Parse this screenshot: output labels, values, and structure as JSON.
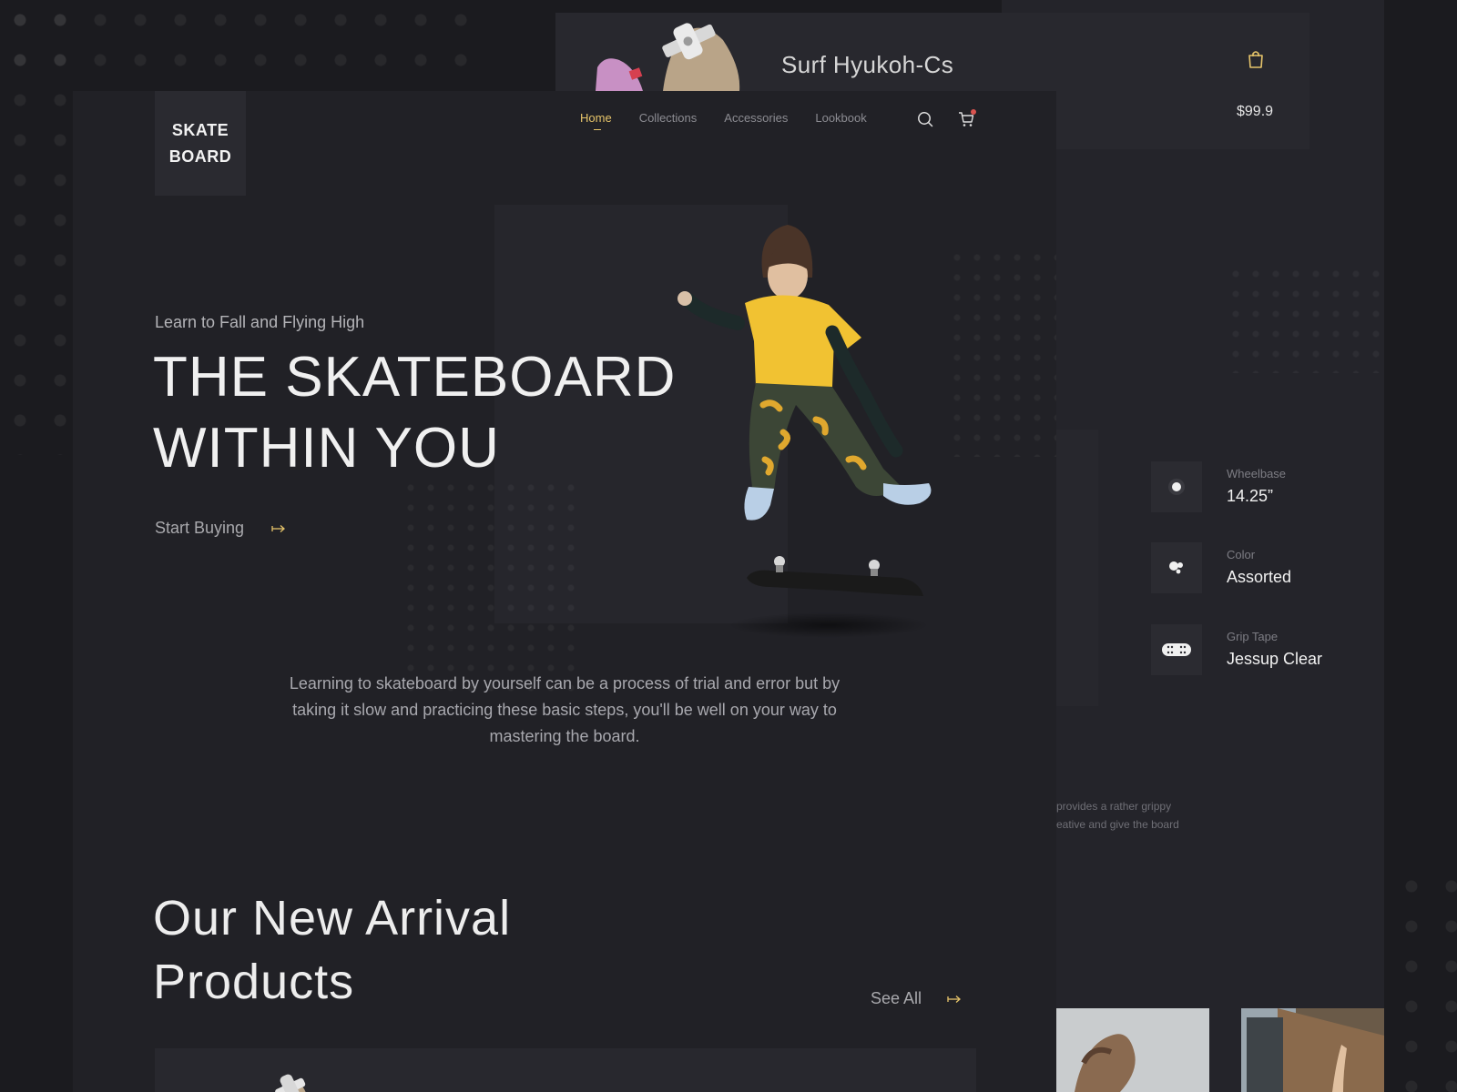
{
  "logo": {
    "line1": "SKATE",
    "line2": "BOARD"
  },
  "nav": {
    "items": [
      {
        "label": "Home",
        "active": true
      },
      {
        "label": "Collections",
        "active": false
      },
      {
        "label": "Accessories",
        "active": false
      },
      {
        "label": "Lookbook",
        "active": false
      }
    ],
    "search_icon": "search-icon",
    "cart_icon": "cart-icon"
  },
  "top_product": {
    "name": "Surf Hyukoh-Cs",
    "price": "$99.9",
    "bag_icon": "shopping-bag-icon"
  },
  "hero": {
    "tagline": "Learn to Fall and Flying High",
    "headline_line1": "THE SKATEBOARD",
    "headline_line2": "WITHIN YOU",
    "cta_label": "Start Buying",
    "description": "Learning to skateboard by yourself can be a process of trial and error but by taking it slow and practicing these basic steps, you'll be well on your way to mastering the board."
  },
  "arrivals": {
    "title_line1": "Our New Arrival",
    "title_line2": "Products",
    "see_all_label": "See All"
  },
  "specs": [
    {
      "label": "Wheelbase",
      "value": "14.25”",
      "icon": "wheel-icon"
    },
    {
      "label": "Color",
      "value": "Assorted",
      "icon": "color-dots-icon"
    },
    {
      "label": "Grip Tape",
      "value": "Jessup Clear",
      "icon": "grip-tape-icon"
    }
  ],
  "side_snippet": {
    "line1": "provides a rather grippy",
    "line2": "eative and give the board"
  },
  "colors": {
    "accent": "#e6c46a",
    "background": "#1b1b1f",
    "page": "#212126",
    "cart_badge": "#d9534f"
  }
}
